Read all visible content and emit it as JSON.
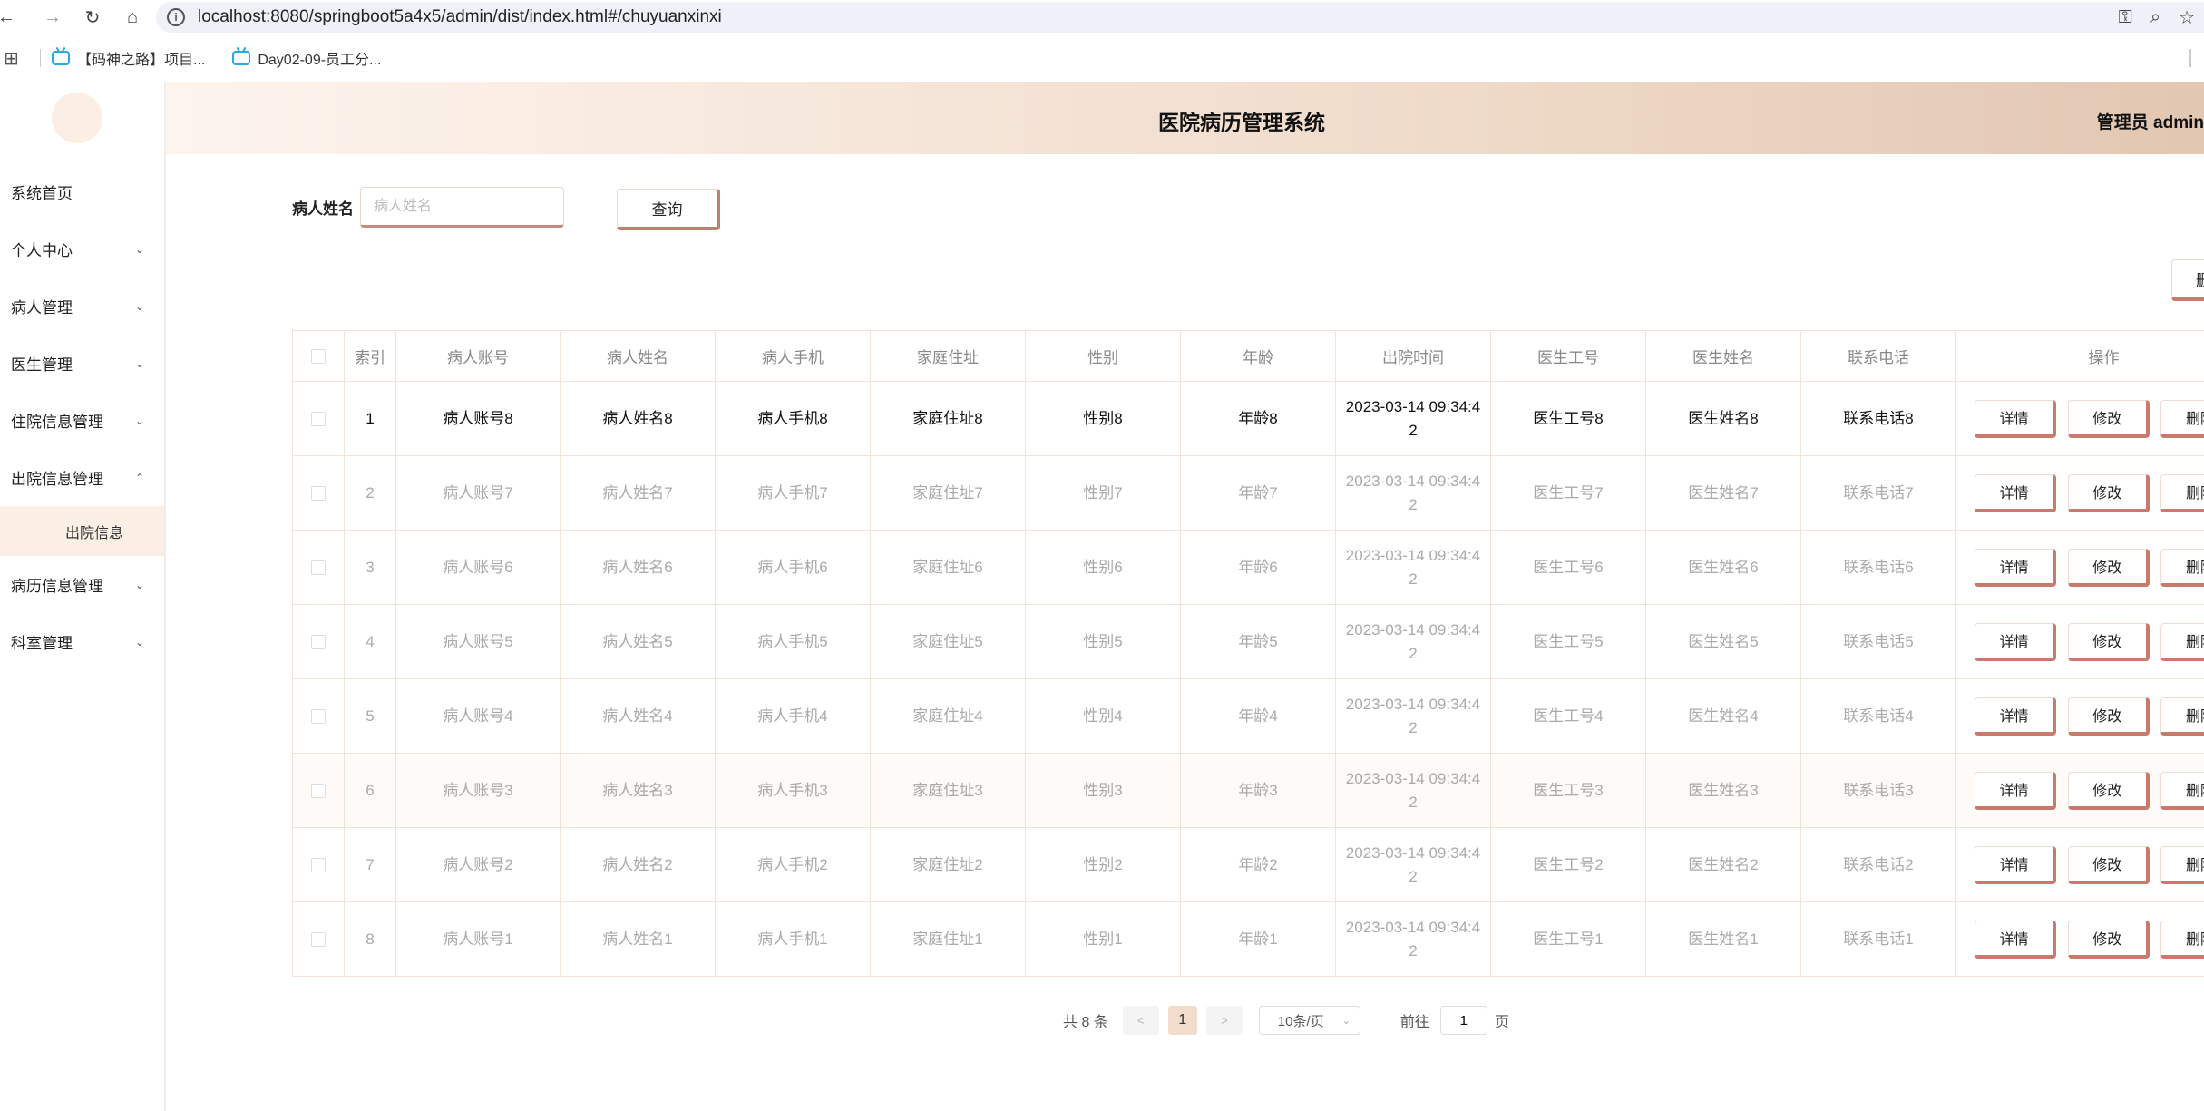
{
  "browser": {
    "url": "localhost:8080/springboot5a4x5/admin/dist/index.html#/chuyuanxinxi",
    "bookmarks": [
      "【码神之路】项目...",
      "Day02-09-员工分..."
    ]
  },
  "header": {
    "title": "医院病历管理系统",
    "user": "管理员 admin"
  },
  "sidebar": {
    "items": [
      {
        "label": "系统首页",
        "chevron": ""
      },
      {
        "label": "个人中心",
        "chevron": "⌄"
      },
      {
        "label": "病人管理",
        "chevron": "⌄"
      },
      {
        "label": "医生管理",
        "chevron": "⌄"
      },
      {
        "label": "住院信息管理",
        "chevron": "⌄"
      },
      {
        "label": "出院信息管理",
        "chevron": "⌃"
      },
      {
        "label": "病历信息管理",
        "chevron": "⌄"
      },
      {
        "label": "科室管理",
        "chevron": "⌄"
      }
    ],
    "submenu_active": "出院信息"
  },
  "search": {
    "label": "病人姓名",
    "placeholder": "病人姓名",
    "button": "查询",
    "delete_button": "删除"
  },
  "table": {
    "headers": [
      "索引",
      "病人账号",
      "病人姓名",
      "病人手机",
      "家庭住址",
      "性别",
      "年龄",
      "出院时间",
      "医生工号",
      "医生姓名",
      "联系电话",
      "操作"
    ],
    "rows": [
      {
        "index": "1",
        "account": "病人账号8",
        "name": "病人姓名8",
        "phone": "病人手机8",
        "address": "家庭住址8",
        "gender": "性别8",
        "age": "年龄8",
        "time1": "2023-03-14 09:34:4",
        "time2": "2",
        "doc_id": "医生工号8",
        "doc_name": "医生姓名8",
        "contact": "联系电话8"
      },
      {
        "index": "2",
        "account": "病人账号7",
        "name": "病人姓名7",
        "phone": "病人手机7",
        "address": "家庭住址7",
        "gender": "性别7",
        "age": "年龄7",
        "time1": "2023-03-14 09:34:4",
        "time2": "2",
        "doc_id": "医生工号7",
        "doc_name": "医生姓名7",
        "contact": "联系电话7"
      },
      {
        "index": "3",
        "account": "病人账号6",
        "name": "病人姓名6",
        "phone": "病人手机6",
        "address": "家庭住址6",
        "gender": "性别6",
        "age": "年龄6",
        "time1": "2023-03-14 09:34:4",
        "time2": "2",
        "doc_id": "医生工号6",
        "doc_name": "医生姓名6",
        "contact": "联系电话6"
      },
      {
        "index": "4",
        "account": "病人账号5",
        "name": "病人姓名5",
        "phone": "病人手机5",
        "address": "家庭住址5",
        "gender": "性别5",
        "age": "年龄5",
        "time1": "2023-03-14 09:34:4",
        "time2": "2",
        "doc_id": "医生工号5",
        "doc_name": "医生姓名5",
        "contact": "联系电话5"
      },
      {
        "index": "5",
        "account": "病人账号4",
        "name": "病人姓名4",
        "phone": "病人手机4",
        "address": "家庭住址4",
        "gender": "性别4",
        "age": "年龄4",
        "time1": "2023-03-14 09:34:4",
        "time2": "2",
        "doc_id": "医生工号4",
        "doc_name": "医生姓名4",
        "contact": "联系电话4"
      },
      {
        "index": "6",
        "account": "病人账号3",
        "name": "病人姓名3",
        "phone": "病人手机3",
        "address": "家庭住址3",
        "gender": "性别3",
        "age": "年龄3",
        "time1": "2023-03-14 09:34:4",
        "time2": "2",
        "doc_id": "医生工号3",
        "doc_name": "医生姓名3",
        "contact": "联系电话3"
      },
      {
        "index": "7",
        "account": "病人账号2",
        "name": "病人姓名2",
        "phone": "病人手机2",
        "address": "家庭住址2",
        "gender": "性别2",
        "age": "年龄2",
        "time1": "2023-03-14 09:34:4",
        "time2": "2",
        "doc_id": "医生工号2",
        "doc_name": "医生姓名2",
        "contact": "联系电话2"
      },
      {
        "index": "8",
        "account": "病人账号1",
        "name": "病人姓名1",
        "phone": "病人手机1",
        "address": "家庭住址1",
        "gender": "性别1",
        "age": "年龄1",
        "time1": "2023-03-14 09:34:4",
        "time2": "2",
        "doc_id": "医生工号1",
        "doc_name": "医生姓名1",
        "contact": "联系电话1"
      }
    ],
    "actions": {
      "detail": "详情",
      "edit": "修改",
      "delete": "删除"
    }
  },
  "pagination": {
    "total": "共 8 条",
    "prev": "<",
    "current": "1",
    "next": ">",
    "page_size": "10条/页",
    "goto_prefix": "前往",
    "goto_value": "1",
    "goto_suffix": "页"
  },
  "colors": {
    "accent": "#c97a6c",
    "header_start": "#fdf4ee",
    "header_end": "#e2c7b2",
    "submenu_bg": "#fbeee4"
  }
}
